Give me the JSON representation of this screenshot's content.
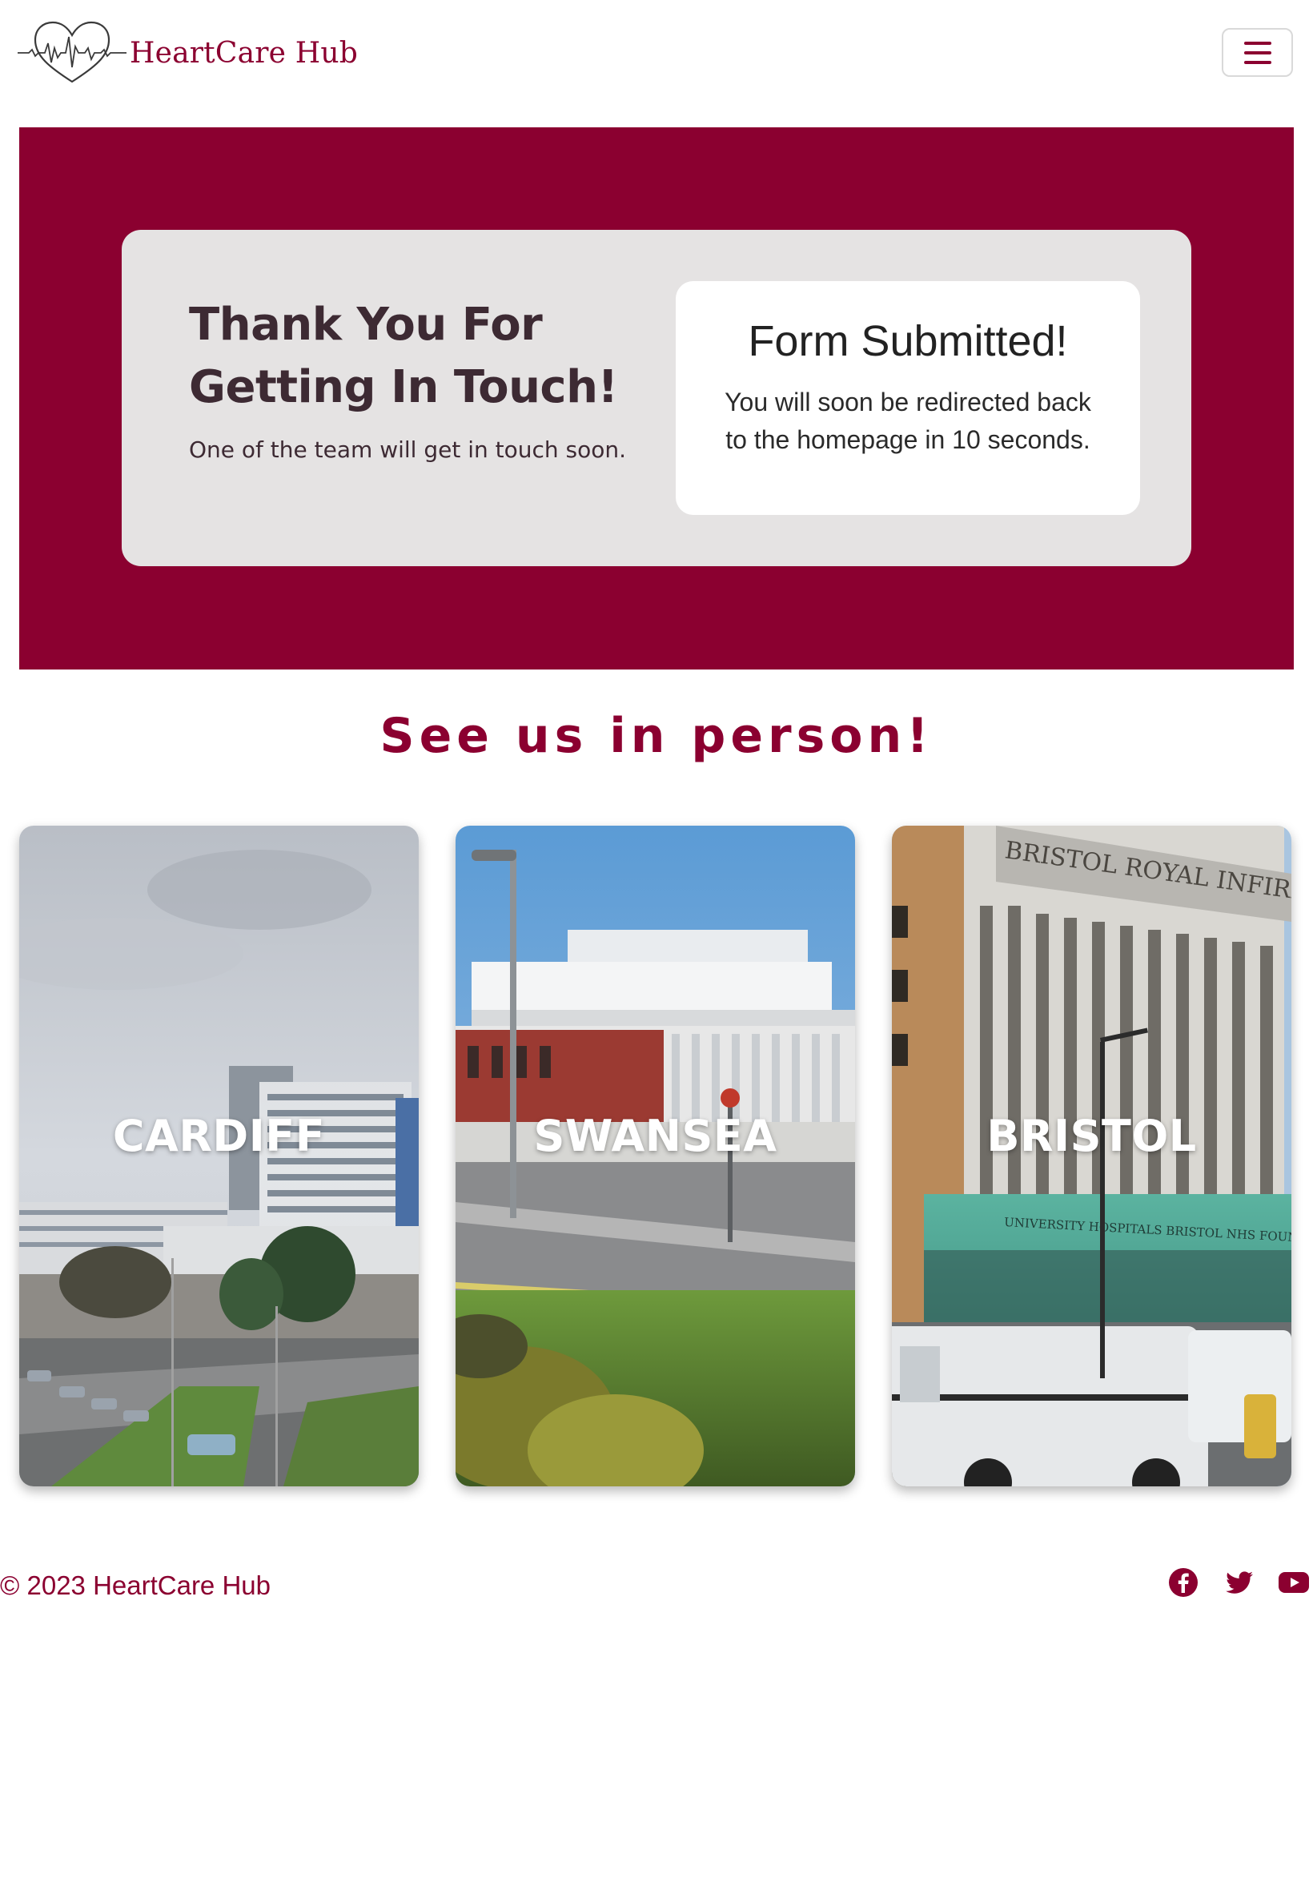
{
  "header": {
    "brand_name": "HeartCare Hub",
    "logo_icon": "heart-ecg-logo",
    "menu_icon": "hamburger-menu-icon"
  },
  "hero": {
    "title_line1": "Thank You For",
    "title_line2": "Getting In Touch!",
    "subtitle": "One of the team will get in touch soon.",
    "notice_title": "Form Submitted!",
    "notice_line1": "You will soon be redirected back",
    "notice_line2": "to the homepage in 10 seconds."
  },
  "locations": {
    "heading": "See us in person!",
    "cards": [
      {
        "label": "CARDIFF"
      },
      {
        "label": "SWANSEA"
      },
      {
        "label": "BRISTOL"
      }
    ],
    "bristol_sign_text": "BRISTOL ROYAL INFIRMAR",
    "bristol_banner_text": "UNIVERSITY HOSPITALS BRISTOL NHS FOUNDATION"
  },
  "footer": {
    "copyright": "© 2023 HeartCare Hub",
    "social_icons": [
      "facebook-icon",
      "twitter-icon",
      "youtube-icon"
    ]
  },
  "colors": {
    "brand": "#8b0030",
    "card_bg": "#e5e3e3",
    "text_dark": "#3d2a33"
  }
}
